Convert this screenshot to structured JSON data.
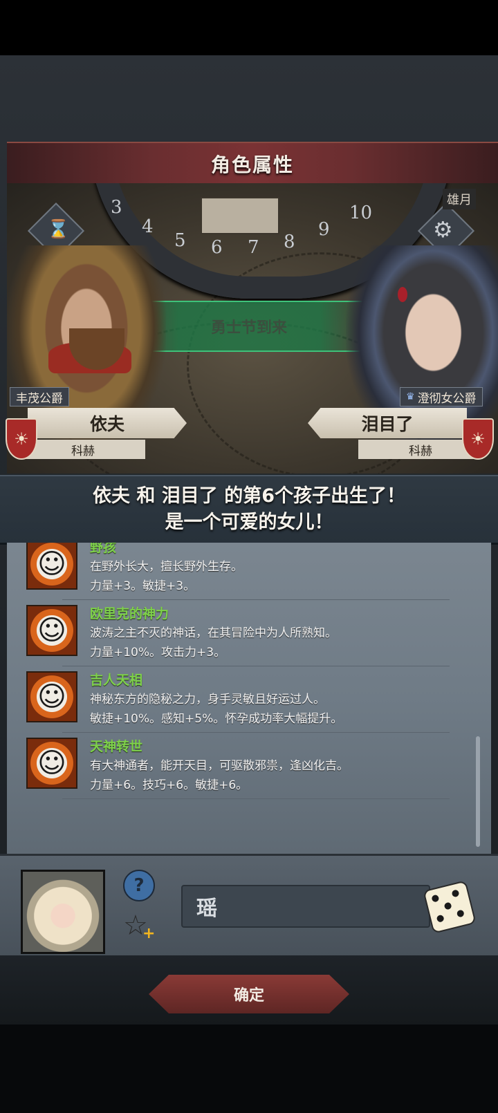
{
  "header": {
    "title": "角色属性"
  },
  "scene": {
    "month_label": "雄月",
    "dial_numbers": [
      "3",
      "4",
      "5",
      "6",
      "7",
      "8",
      "9",
      "10"
    ],
    "event_text": "勇士节到来"
  },
  "father": {
    "title": "丰茂公爵",
    "name": "依夫",
    "house": "科赫"
  },
  "mother": {
    "title": "澄彻女公爵",
    "name": "泪目了",
    "house": "科赫"
  },
  "announcement": {
    "line1": "依夫 和 泪目了 的第6个孩子出生了！",
    "line2": "是一个可爱的女儿！"
  },
  "traits": [
    {
      "name": "野孩",
      "desc": "在野外长大，擅长野外生存。",
      "effect": "力量+3。敏捷+3。",
      "icon": "smiley-sun-icon"
    },
    {
      "name": "欧里克的神力",
      "desc": "波涛之主不灭的神话，在其冒险中为人所熟知。",
      "effect": "力量+10%。攻击力+3。",
      "icon": "smiley-sun-icon"
    },
    {
      "name": "吉人天相",
      "desc": "神秘东方的隐秘之力，身手灵敏且好运过人。",
      "effect": "敏捷+10%。感知+5%。怀孕成功率大幅提升。",
      "icon": "smiley-sun-icon"
    },
    {
      "name": "天神转世",
      "desc": "有大神通者，能开天目，可驱散邪祟，逢凶化吉。",
      "effect": "力量+6。技巧+6。敏捷+6。",
      "icon": "smiley-sun-icon"
    }
  ],
  "child": {
    "name_value": "瑶",
    "help_symbol": "?",
    "star_symbol": "☆",
    "plus_symbol": "+"
  },
  "footer": {
    "confirm_label": "确定"
  },
  "colors": {
    "trait_name": "#7ed14a",
    "title_bar": "#6a2e30",
    "event_banner": "#3ec27a"
  }
}
